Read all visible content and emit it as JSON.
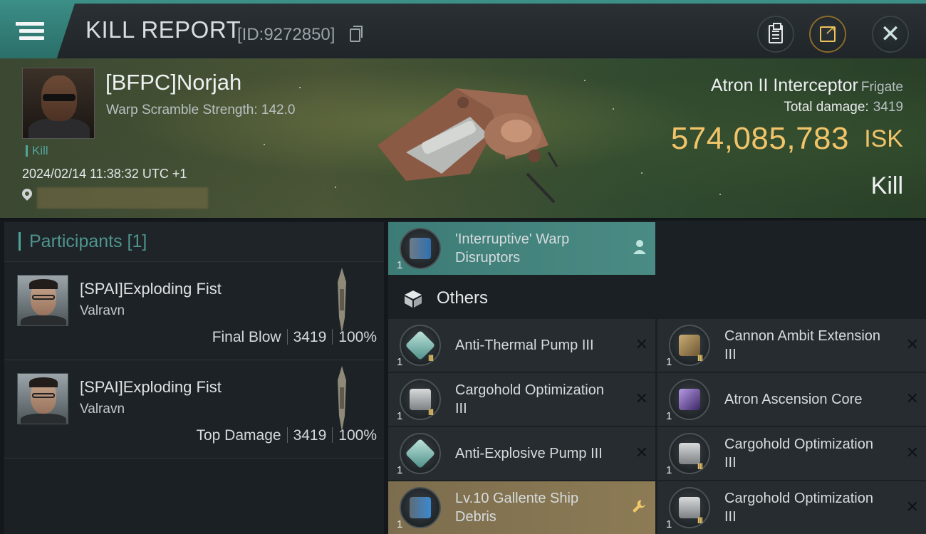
{
  "header": {
    "title": "KILL REPORT",
    "report_id": "[ID:9272850]"
  },
  "victim": {
    "name": "[BFPC]Norjah",
    "warp_label": "Warp Scramble Strength: 142.0",
    "tag": "Kill",
    "timestamp": "2024/02/14 11:38:32 UTC +1",
    "ship_name": "Atron II Interceptor",
    "ship_class": "Frigate",
    "total_damage_label": "Total damage:",
    "total_damage": "3419",
    "isk_value": "574,085,783",
    "isk_unit": "ISK",
    "result": "Kill"
  },
  "participants": {
    "header": "Participants [1]",
    "rows": [
      {
        "name": "[SPAI]Exploding Fist",
        "ship": "Valravn",
        "role": "Final Blow",
        "damage": "3419",
        "percent": "100%"
      },
      {
        "name": "[SPAI]Exploding Fist",
        "ship": "Valravn",
        "role": "Top Damage",
        "damage": "3419",
        "percent": "100%"
      }
    ]
  },
  "items": {
    "featured": {
      "name": "'Interruptive' Warp Disruptors",
      "qty": "1",
      "icon": "warp-disruptor-icon"
    },
    "section_title": "Others",
    "list": [
      {
        "name": "Anti-Thermal Pump III",
        "qty": "1",
        "tier": "III",
        "icon": "pump-icon"
      },
      {
        "name": "Cannon Ambit Extension III",
        "qty": "1",
        "tier": "III",
        "icon": "cannon-icon"
      },
      {
        "name": "Cargohold Optimization III",
        "qty": "1",
        "tier": "III",
        "icon": "cargo-icon"
      },
      {
        "name": "Atron Ascension Core",
        "qty": "1",
        "tier": "",
        "icon": "core-icon"
      },
      {
        "name": "Anti-Explosive Pump III",
        "qty": "1",
        "tier": "III",
        "icon": "pump-icon"
      },
      {
        "name": "Cargohold Optimization III",
        "qty": "1",
        "tier": "III",
        "icon": "cargo-icon"
      },
      {
        "name": "Lv.10 Gallente Ship Debris",
        "qty": "1",
        "tier": "",
        "icon": "debris-icon"
      },
      {
        "name": "Cargohold Optimization III",
        "qty": "1",
        "tier": "III",
        "icon": "cargo-icon"
      }
    ]
  },
  "colors": {
    "accent": "#3c8f86",
    "isk_gold": "#f1c46a",
    "highlight_teal": "#4a8b84",
    "highlight_gold": "#8c7b55"
  }
}
